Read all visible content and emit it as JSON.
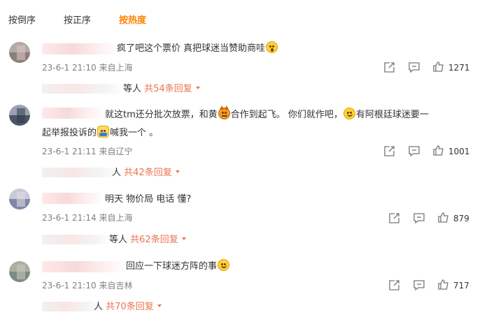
{
  "tabs": [
    "按倒序",
    "按正序",
    "按热度"
  ],
  "accent_color": "#ff8200",
  "reply_link_color": "#eb7350",
  "actions": {
    "share_icon": "share-icon",
    "comment_icon": "comment-icon",
    "like_icon": "thumbs-up-icon"
  },
  "comments": [
    {
      "text_lines": [
        [
          "疯了吧这个票价 真把球迷当赞助商哇",
          ":shock"
        ]
      ],
      "time": "23-6-1 21:10",
      "location": "来自上海",
      "likes": "1271",
      "reply_prefix": "等人",
      "reply_more": "共54条回复",
      "emoji_names": [
        "shocked-face-emoji"
      ]
    },
    {
      "text_lines": [
        [
          "就这tm还分批次放票，和黄",
          ":devil",
          "合作到起飞。  你们就作吧，",
          ":smile",
          "有阿根廷球迷要一"
        ],
        [
          "起举报投诉的",
          ":call",
          "喊我一个 。"
        ]
      ],
      "time": "23-6-1 21:11",
      "location": "来自辽宁",
      "likes": "1001",
      "reply_prefix": "人",
      "reply_more": "共42条回复",
      "emoji_names": [
        "devil-face-emoji",
        "smile-face-emoji",
        "phone-call-emoji"
      ]
    },
    {
      "text_lines": [
        [
          "明天 物价局 电话 懂?"
        ]
      ],
      "time": "23-6-1 21:14",
      "location": "来自上海",
      "likes": "879",
      "reply_prefix": "等人",
      "reply_more": "共62条回复",
      "emoji_names": []
    },
    {
      "text_lines": [
        [
          "回应一下球迷方阵的事",
          ":smile"
        ]
      ],
      "time": "23-6-1 21:10",
      "location": "来自吉林",
      "likes": "717",
      "reply_prefix": "人",
      "reply_more": "共70条回复",
      "emoji_names": [
        "smile-face-emoji"
      ]
    }
  ]
}
